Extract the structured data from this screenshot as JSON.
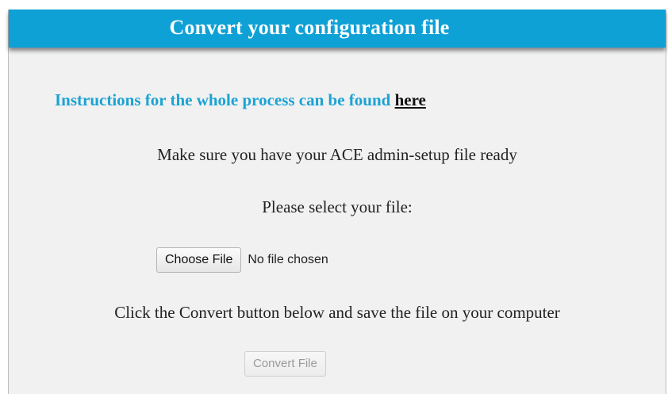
{
  "header": {
    "title": "Convert your configuration file"
  },
  "instructions": {
    "text": "Instructions for the whole process can be found ",
    "link_label": "here"
  },
  "steps": {
    "make_sure": "Make sure you have your ACE admin-setup file ready",
    "select_file": "Please select your file:",
    "click_convert": "Click the Convert button below and save the file on your computer"
  },
  "file_input": {
    "button_label": "Choose File",
    "status": "No file chosen"
  },
  "convert": {
    "button_label": "Convert File",
    "disabled": true
  },
  "colors": {
    "header_bg": "#0ea1d6",
    "instructions_text": "#1aa3d4",
    "panel_bg": "#f1f1f1"
  }
}
